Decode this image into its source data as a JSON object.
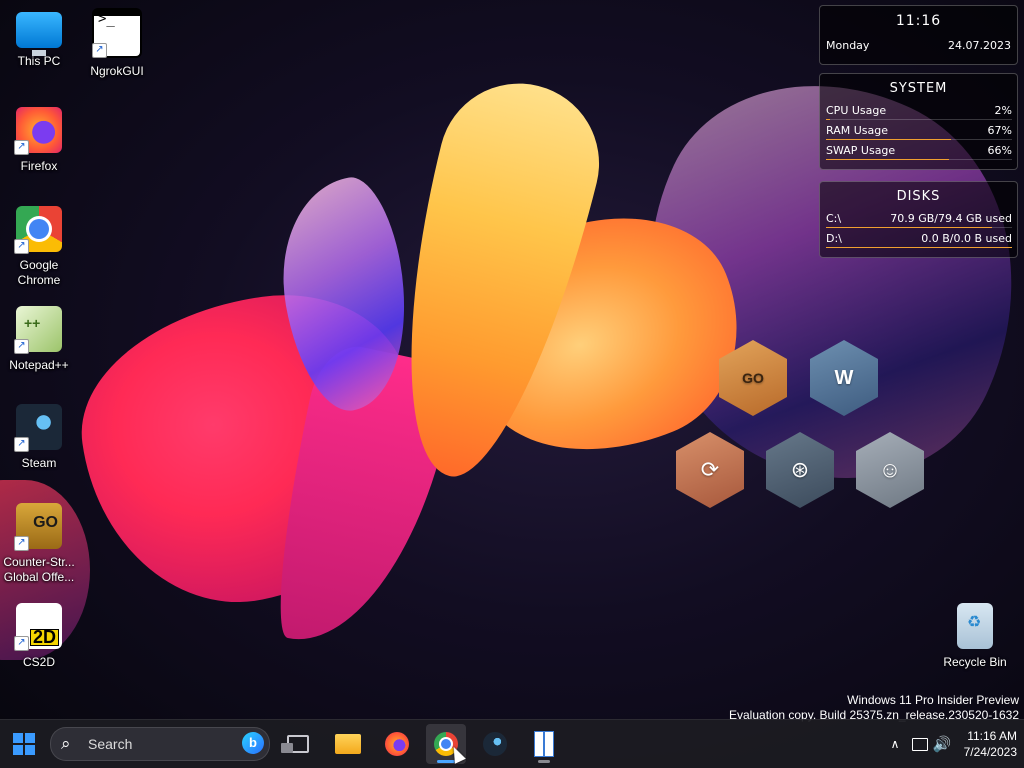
{
  "desktop": {
    "icons": [
      {
        "label": "This PC",
        "icon": "computer-icon"
      },
      {
        "label": "NgrokGUI",
        "icon": "terminal-icon"
      },
      {
        "label": "Firefox",
        "icon": "firefox-icon"
      },
      {
        "label": "Google Chrome",
        "icon": "chrome-icon"
      },
      {
        "label": "Notepad++",
        "icon": "notepadpp-icon"
      },
      {
        "label": "Steam",
        "icon": "steam-icon"
      },
      {
        "label": "Counter-Str... Global Offe...",
        "icon": "csgo-icon"
      },
      {
        "label": "CS2D",
        "icon": "cs2d-icon"
      },
      {
        "label": "Recycle Bin",
        "icon": "recycle-bin-icon"
      }
    ],
    "shortcut_arrow": "↗"
  },
  "widgets": {
    "clock": {
      "time": "11:16",
      "day": "Monday",
      "date": "24.07.2023"
    },
    "system": {
      "title": "SYSTEM",
      "rows": [
        {
          "label": "CPU Usage",
          "value": "2%",
          "fraction": 0.02
        },
        {
          "label": "RAM Usage",
          "value": "67%",
          "fraction": 0.67
        },
        {
          "label": "SWAP Usage",
          "value": "66%",
          "fraction": 0.66
        }
      ]
    },
    "disks": {
      "title": "DISKS",
      "rows": [
        {
          "label": "C:\\",
          "value": "70.9 GB/79.4 GB used",
          "fraction": 0.893
        },
        {
          "label": "D:\\",
          "value": "0.0 B/0.0 B used",
          "fraction": 1.0
        }
      ]
    }
  },
  "launcher": {
    "items": [
      {
        "name": "csgo",
        "glyph": "GO"
      },
      {
        "name": "wallpaper-engine",
        "glyph": "W"
      },
      {
        "name": "ccleaner",
        "glyph": "⟳"
      },
      {
        "name": "steam",
        "glyph": "⊛"
      },
      {
        "name": "discord",
        "glyph": "☺"
      }
    ]
  },
  "watermark": {
    "line1": "Windows 11 Pro Insider Preview",
    "line2": "Evaluation copy. Build 25375.zn_release.230520-1632"
  },
  "taskbar": {
    "search_placeholder": "Search",
    "search_icon": "⌕",
    "bing_glyph": "b",
    "apps": [
      {
        "name": "task-view",
        "active": false
      },
      {
        "name": "file-explorer",
        "active": false
      },
      {
        "name": "firefox",
        "active": false
      },
      {
        "name": "chrome",
        "active": true
      },
      {
        "name": "steam",
        "active": false
      },
      {
        "name": "books-app",
        "active": false
      }
    ],
    "tray": {
      "chevron": "∧",
      "volume": "🔊",
      "time": "11:16 AM",
      "date": "7/24/2023"
    }
  },
  "colors": {
    "accent": "#4ba6ff",
    "meter_bar": "#f0a030",
    "start_logo": "#3a9bff"
  }
}
